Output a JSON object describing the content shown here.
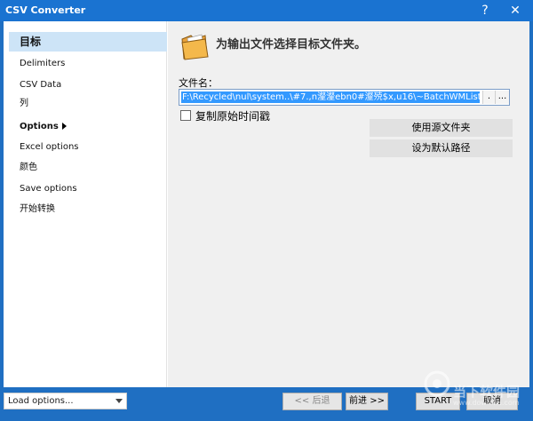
{
  "window": {
    "title": "CSV Converter",
    "help_glyph": "?",
    "close_glyph": "✕"
  },
  "sidebar": {
    "items": [
      {
        "label": "目标",
        "active": true
      },
      {
        "label": "Delimiters"
      },
      {
        "label": "CSV Data"
      },
      {
        "label": "列"
      },
      {
        "label": "Options",
        "has_arrow": true
      },
      {
        "label": "Excel options"
      },
      {
        "label": "颜色"
      },
      {
        "label": "Save options"
      },
      {
        "label": "开始转换"
      }
    ]
  },
  "main": {
    "header": "为输出文件选择目标文件夹。",
    "file_label": "文件名：",
    "file_path": "F:\\Recycled\\nul\\system..\\#7.,n瀣瀣ebn0#瀣殑$x,u16\\~BatchWMList.xls",
    "path_btn_dot": ".",
    "path_btn_more": "...",
    "checkbox_label": "复制原始时间戳",
    "checkbox_checked": false,
    "btn_use_source": "使用源文件夹",
    "btn_set_default": "设为默认路径"
  },
  "footer": {
    "load_options": "Load options...",
    "back": "<< 后退",
    "next": "前进 >>",
    "start": "START",
    "cancel": "取消"
  },
  "watermark": {
    "line1": "当下软件园",
    "line2": "www.downxia.com"
  },
  "colors": {
    "titlebar": "#1a73d1",
    "footer": "#1f6fc2",
    "selected_item": "#cde4f7",
    "selection": "#3399ff",
    "main_bg": "#f0f0f0"
  }
}
